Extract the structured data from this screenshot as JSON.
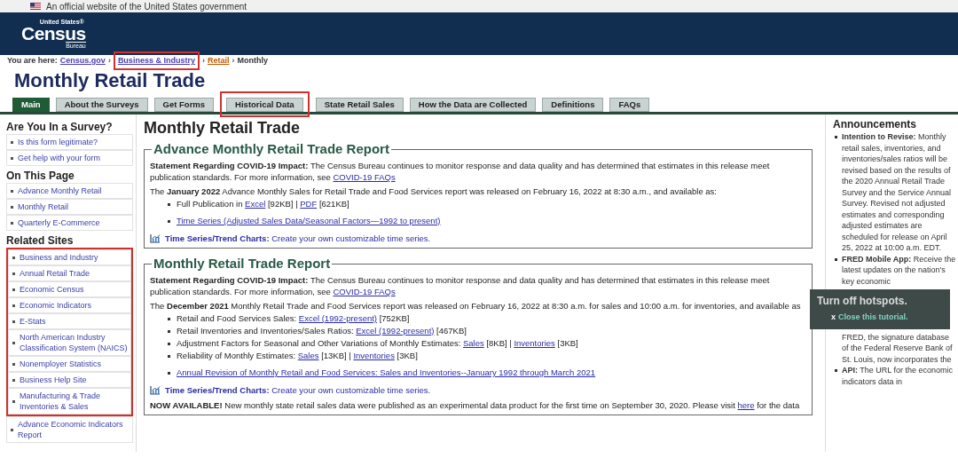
{
  "gov_banner": {
    "text": "An official website of the United States government"
  },
  "logo": {
    "top": "United States®",
    "main": "Census",
    "bottom": "Bureau"
  },
  "breadcrumb": {
    "label": "You are here:",
    "separator": "›",
    "items": [
      {
        "text": "Census.gov",
        "kind": "link",
        "highlighted": false
      },
      {
        "text": "Business & Industry",
        "kind": "link",
        "highlighted": true
      },
      {
        "text": "Retail",
        "kind": "link",
        "highlighted": false
      },
      {
        "text": "Monthly",
        "kind": "current",
        "highlighted": false
      }
    ]
  },
  "page_title": "Monthly Retail Trade",
  "tabs": [
    {
      "label": "Main",
      "selected": true,
      "highlighted": false
    },
    {
      "label": "About the Surveys",
      "selected": false,
      "highlighted": false
    },
    {
      "label": "Get Forms",
      "selected": false,
      "highlighted": false
    },
    {
      "label": "Historical Data",
      "selected": false,
      "highlighted": true
    },
    {
      "label": "State Retail Sales",
      "selected": false,
      "highlighted": false
    },
    {
      "label": "How the Data are Collected",
      "selected": false,
      "highlighted": false
    },
    {
      "label": "Definitions",
      "selected": false,
      "highlighted": false
    },
    {
      "label": "FAQs",
      "selected": false,
      "highlighted": false
    }
  ],
  "sidebar": {
    "sections": [
      {
        "title": "Are You In a Survey?",
        "groups": [
          {
            "highlighted": false,
            "items": [
              "Is this form legitimate?",
              "Get help with your form"
            ]
          }
        ]
      },
      {
        "title": "On This Page",
        "groups": [
          {
            "highlighted": false,
            "items": [
              "Advance Monthly Retail",
              "Monthly Retail",
              "Quarterly E-Commerce"
            ]
          }
        ]
      },
      {
        "title": "Related Sites",
        "groups": [
          {
            "highlighted": true,
            "items": [
              "Business and Industry",
              "Annual Retail Trade",
              "Economic Census",
              "Economic Indicators",
              "E-Stats",
              "North American Industry Classification System (NAICS)",
              "Nonemployer Statistics",
              "Business Help Site",
              "Manufacturing & Trade Inventories & Sales"
            ]
          },
          {
            "highlighted": false,
            "items": [
              "Advance Economic Indicators Report"
            ]
          }
        ]
      }
    ]
  },
  "main": {
    "title": "Monthly Retail Trade",
    "sections": [
      {
        "title": "Advance Monthly Retail Trade Report",
        "paragraphs": [
          [
            {
              "text": "**Statement Regarding COVID-19 Impact:** The Census Bureau continues to monitor response and data quality and has determined that estimates in this release meet publication standards. For more information, see "
            },
            {
              "link": "COVID-19 FAQs"
            }
          ],
          [
            {
              "text": "The **January 2022** Advance Monthly Sales for Retail Trade and Food Services report was released on February 16, 2022 at 8:30 a.m., and available as:"
            }
          ]
        ],
        "bullet_groups": [
          [
            [
              {
                "text": "Full Publication in "
              },
              {
                "link": "Excel"
              },
              {
                "text": " [92KB] | "
              },
              {
                "link": "PDF"
              },
              {
                "text": " [621KB]"
              }
            ]
          ],
          [
            [
              {
                "link": "Time Series (Adjusted Sales Data/Seasonal Factors—1992 to present)"
              }
            ]
          ]
        ],
        "trend": {
          "label": "Time Series/Trend Charts:",
          "text": "Create your own customizable time series."
        }
      },
      {
        "title": "Monthly Retail Trade Report",
        "paragraphs": [
          [
            {
              "text": "**Statement Regarding COVID-19 Impact:** The Census Bureau continues to monitor response and data quality and has determined that estimates in this release meet publication standards. For more information, see "
            },
            {
              "link": "COVID-19 FAQs"
            }
          ],
          [
            {
              "text": "The **December 2021** Monthly Retail Trade and Food Services report was released on February 16, 2022 at 8:30 a.m. for sales and 10:00 a.m. for inventories, and available as"
            }
          ]
        ],
        "bullet_groups": [
          [
            [
              {
                "text": "Retail and Food Services Sales: "
              },
              {
                "link": "Excel (1992-present)"
              },
              {
                "text": " [752KB]"
              }
            ],
            [
              {
                "text": "Retail Inventories and Inventories/Sales Ratios: "
              },
              {
                "link": "Excel (1992-present)"
              },
              {
                "text": " [467KB]"
              }
            ],
            [
              {
                "text": "Adjustment Factors for Seasonal and Other Variations of Monthly Estimates: "
              },
              {
                "link": "Sales"
              },
              {
                "text": " [8KB] | "
              },
              {
                "link": "Inventories"
              },
              {
                "text": " [3KB]"
              }
            ],
            [
              {
                "text": "Reliability of Monthly Estimates: "
              },
              {
                "link": "Sales"
              },
              {
                "text": " [13KB] | "
              },
              {
                "link": "Inventories"
              },
              {
                "text": " [3KB]"
              }
            ]
          ],
          [
            [
              {
                "link": "Annual Revision of Monthly Retail and Food Services: Sales and Inventories--January 1992 through March 2021"
              }
            ]
          ]
        ],
        "trend": {
          "label": "Time Series/Trend Charts:",
          "text": "Create your own customizable time series."
        },
        "notice": [
          {
            "text": "**NOW AVAILABLE!** New monthly state retail sales data were published as an experimental data product for the first time on September 30, 2020. Please visit "
          },
          {
            "link": "here"
          },
          {
            "text": " for the data"
          }
        ]
      }
    ]
  },
  "announcements": {
    "title": "Announcements",
    "entries": [
      {
        "kind": "item",
        "title": "Intention to Revise:",
        "text": "Monthly retail sales, inventories, and inventories/sales ratios will be revised based on the results of the 2020 Annual Retail Trade Survey and the Service Annual Survey. Revised not adjusted estimates and corresponding adjusted estimates are scheduled for release on April 25, 2022 at 10:00 a.m. EDT."
      },
      {
        "kind": "item",
        "title": "FRED Mobile App:",
        "text": "Receive the latest updates on the nation's key economic"
      },
      {
        "kind": "overlay",
        "title": "Turn off hotspots.",
        "close_mark": "x",
        "link": "Close this tutorial."
      },
      {
        "kind": "continuation",
        "text": "FRED, the signature database of the Federal Reserve Bank of St. Louis, now incorporates the"
      },
      {
        "kind": "item",
        "title": "API:",
        "text": "The URL for the economic indicators data in"
      }
    ]
  }
}
